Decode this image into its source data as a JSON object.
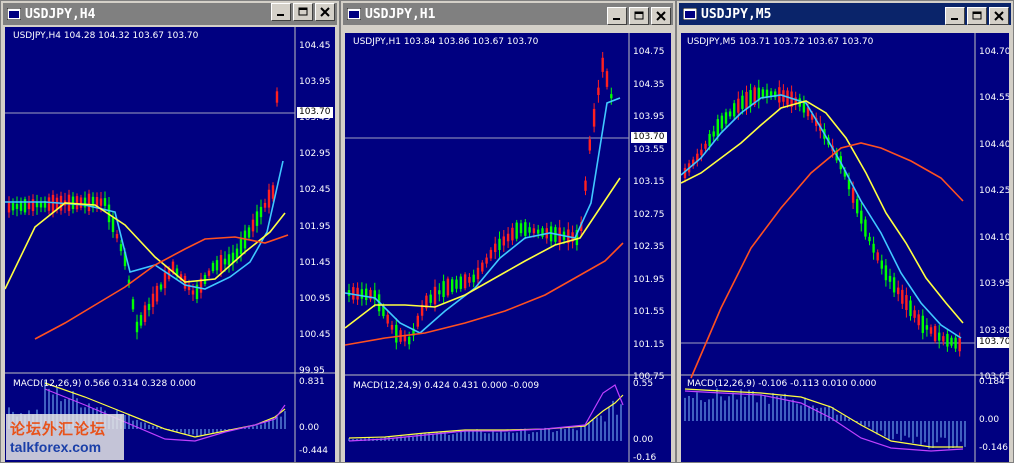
{
  "windows": [
    {
      "id": "h4",
      "title": "USDJPY,H4",
      "active": false,
      "header": "USDJPY,H4  104.28  104.32  103.67  103.70",
      "price_ticks": [
        "104.45",
        "103.95",
        "103.45",
        "102.95",
        "102.45",
        "101.95",
        "101.45",
        "100.95",
        "100.45",
        "99.95"
      ],
      "current_price": "103.70",
      "macd_label": "MACD(12,26,9) 0.566 0.314 0.328 0.000",
      "macd_ticks": [
        "0.831",
        "0.00",
        "-0.444"
      ]
    },
    {
      "id": "h1",
      "title": "USDJPY,H1",
      "active": false,
      "header": "USDJPY,H1  103.84  103.86  103.67  103.70",
      "price_ticks": [
        "104.75",
        "104.35",
        "103.95",
        "103.55",
        "103.15",
        "102.75",
        "102.35",
        "101.95",
        "101.55",
        "101.15",
        "100.75"
      ],
      "current_price": "103.70",
      "macd_label": "MACD(12,24,9) 0.424 0.431 0.000 -0.009",
      "macd_ticks": [
        "0.55",
        "0.00",
        "-0.16"
      ]
    },
    {
      "id": "m5",
      "title": "USDJPY,M5",
      "active": true,
      "header": "USDJPY,M5  103.71  103.72  103.67  103.70",
      "price_ticks": [
        "104.70",
        "104.55",
        "104.40",
        "104.25",
        "104.10",
        "103.95",
        "103.80",
        "103.65"
      ],
      "current_price": "103.70",
      "macd_label": "MACD(12,26,9) -0.106 -0.113 0.010 0.000",
      "macd_ticks": [
        "0.184",
        "0.00",
        "-0.146"
      ]
    }
  ],
  "watermark": {
    "line1": "论坛外汇论坛",
    "line2": "talkforex.com"
  },
  "colors": {
    "chart_bg": "#000080",
    "bull": "#00ff00",
    "bear": "#ff2020",
    "ma_fast": "#40c8ff",
    "ma_mid": "#ffff40",
    "ma_slow": "#ff5020",
    "macd_hist": "#80c0ff",
    "macd_signal": "#ffff40",
    "macd_main": "#c040ff",
    "active_title": "#0a246a",
    "inactive_title": "#808080"
  },
  "icons": [
    "app-icon",
    "minimize-icon",
    "maximize-icon",
    "close-icon"
  ]
}
